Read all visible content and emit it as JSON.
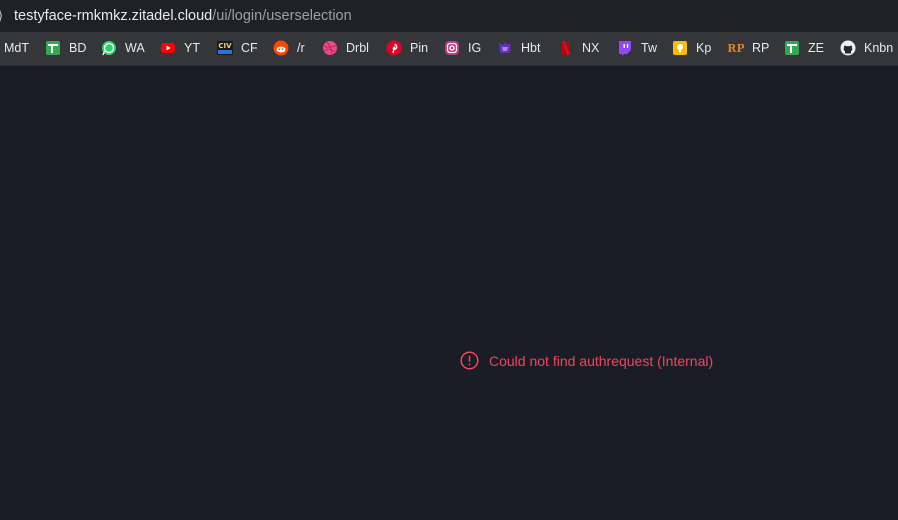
{
  "browser": {
    "url_host": "testyface-rmkmkz.zitadel.cloud",
    "url_path": "/ui/login/userselection"
  },
  "bookmarks": [
    {
      "label": "MdT",
      "icon": "bookmark-icon"
    },
    {
      "label": "BD",
      "icon": "google-sheets-icon"
    },
    {
      "label": "WA",
      "icon": "whatsapp-icon"
    },
    {
      "label": "YT",
      "icon": "youtube-icon"
    },
    {
      "label": "CF",
      "icon": "civ-icon"
    },
    {
      "label": "/r",
      "icon": "reddit-icon"
    },
    {
      "label": "Drbl",
      "icon": "dribbble-icon"
    },
    {
      "label": "Pin",
      "icon": "pinterest-icon"
    },
    {
      "label": "IG",
      "icon": "instagram-icon"
    },
    {
      "label": "Hbt",
      "icon": "habitica-icon"
    },
    {
      "label": "NX",
      "icon": "netflix-icon"
    },
    {
      "label": "Tw",
      "icon": "twitch-icon"
    },
    {
      "label": "Kp",
      "icon": "google-keep-icon"
    },
    {
      "label": "RP",
      "icon": "rp-icon"
    },
    {
      "label": "ZE",
      "icon": "google-sheets-icon"
    },
    {
      "label": "Knbn",
      "icon": "github-icon"
    }
  ],
  "error": {
    "message": "Could not find authrequest (Internal)",
    "icon": "error-circle-icon",
    "color": "#f0455f"
  }
}
